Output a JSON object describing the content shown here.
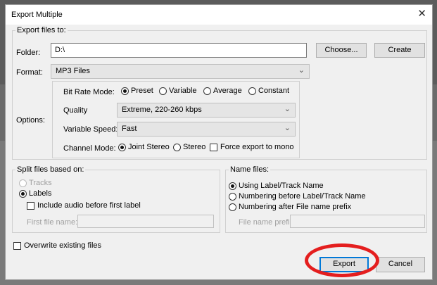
{
  "dialog": {
    "title": "Export Multiple",
    "close_glyph": "✕"
  },
  "export_to": {
    "legend": "Export files to:",
    "folder_label": "Folder:",
    "folder_value": "D:\\",
    "choose_label": "Choose...",
    "create_label": "Create",
    "format_label": "Format:",
    "format_value": "MP3 Files"
  },
  "options": {
    "label": "Options:",
    "bit_rate_mode_label": "Bit Rate Mode:",
    "bit_rate_modes": [
      "Preset",
      "Variable",
      "Average",
      "Constant"
    ],
    "bit_rate_selected": "Preset",
    "quality_label": "Quality",
    "quality_value": "Extreme, 220-260 kbps",
    "variable_speed_label": "Variable Speed:",
    "variable_speed_value": "Fast",
    "channel_mode_label": "Channel Mode:",
    "channel_modes": [
      "Joint Stereo",
      "Stereo"
    ],
    "channel_selected": "Joint Stereo",
    "force_mono_label": "Force export to mono",
    "force_mono_checked": false
  },
  "split": {
    "legend": "Split files based on:",
    "tracks_label": "Tracks",
    "labels_label": "Labels",
    "selected": "Labels",
    "include_audio_label": "Include audio before first label",
    "include_audio_checked": false,
    "first_file_name_label": "First file name:",
    "first_file_name_value": ""
  },
  "name_files": {
    "legend": "Name files:",
    "options": [
      "Using Label/Track Name",
      "Numbering before Label/Track Name",
      "Numbering after File name prefix"
    ],
    "selected": "Using Label/Track Name",
    "prefix_label": "File name prefix:",
    "prefix_value": ""
  },
  "overwrite": {
    "label": "Overwrite existing files",
    "checked": false
  },
  "footer": {
    "export_label": "Export",
    "cancel_label": "Cancel"
  },
  "colors": {
    "annotation_circle": "#e41e1e",
    "default_button_border": "#0078d7"
  }
}
